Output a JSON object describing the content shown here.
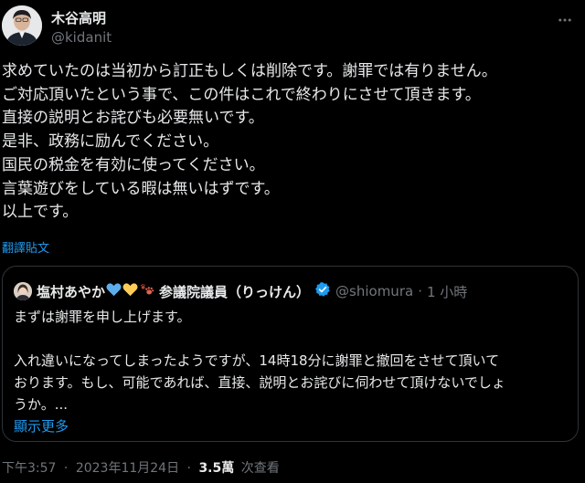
{
  "author": {
    "name": "木谷高明",
    "handle": "@kidanit"
  },
  "body_lines": [
    "求めていたのは当初から訂正もしくは削除です。謝罪では有りません。",
    "ご対応頂いたという事で、この件はこれで終わりにさせて頂きます。",
    "直接の説明とお詫びも必要無いです。",
    "是非、政務に励んでください。",
    "国民の税金を有効に使ってください。",
    "言葉遊びをしている暇は無いはずです。",
    "以上です。"
  ],
  "translate_label": "翻譯貼文",
  "quote": {
    "name": "塩村あやか",
    "name_suffix": "参議院議員（りっけん）",
    "handle": "@shiomura",
    "separator": "·",
    "time": "1 小時",
    "lines": [
      "まずは謝罪を申し上げます。",
      "",
      "入れ違いになってしまったようですが、14時18分に謝罪と撤回をさせて頂いて",
      "おります。もし、可能であれば、直接、説明とお詫びに伺わせて頂けないでしょ",
      "うか。..."
    ],
    "show_more": "顯示更多"
  },
  "meta": {
    "time": "下午3:57",
    "separator": "·",
    "date": "2023年11月24日",
    "views_count": "3.5萬",
    "views_label": "次查看"
  },
  "colors": {
    "background": "#000000",
    "text": "#e7e9ea",
    "muted": "#71767b",
    "link": "#1d9bf0",
    "border": "#2f3336"
  },
  "icons": {
    "more": "more-horizontal-icon",
    "verified": "verified-badge-icon"
  }
}
